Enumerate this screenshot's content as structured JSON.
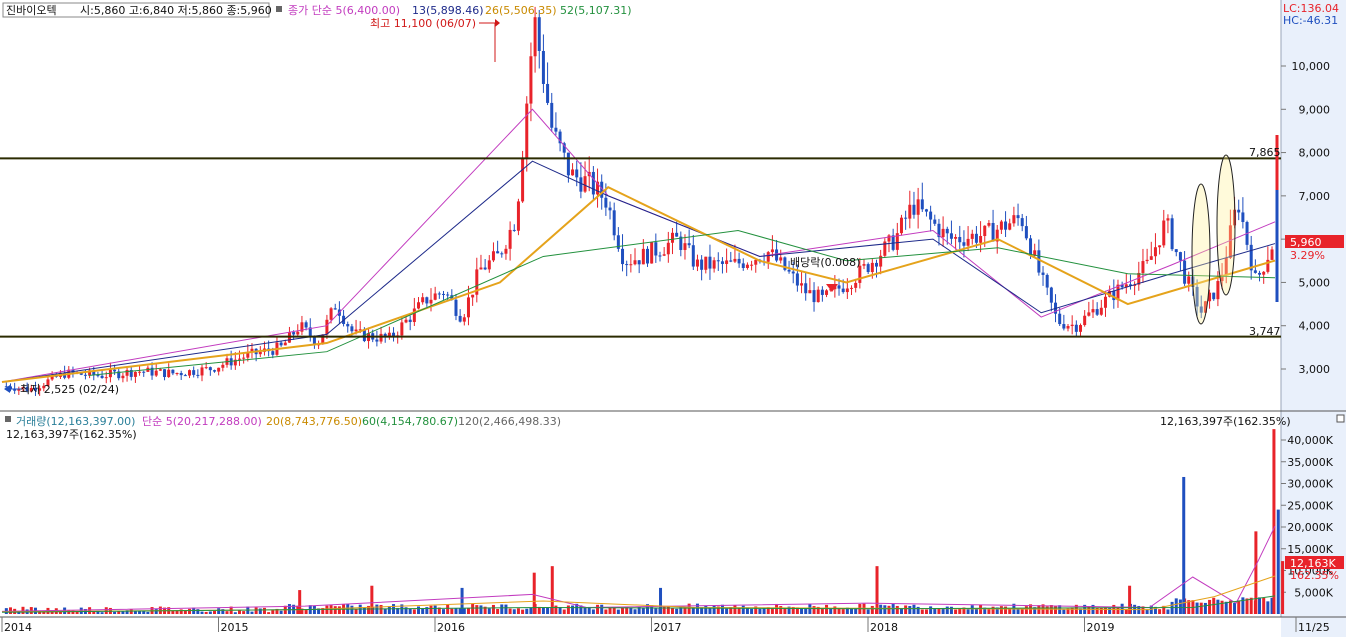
{
  "title_box": {
    "stock": "진바이오텍",
    "ohlc": "시:5,860 고:6,840 저:5,860 종:5,960"
  },
  "price_legend": {
    "base": "종가 단순 5(6,400.00)",
    "ma13": "13(5,898.46)",
    "ma26": "26(5,506.35)",
    "ma52": "52(5,107.31)"
  },
  "lc_hc": {
    "lc": "LC:136.04",
    "hc": "HC:-46.31"
  },
  "annotations": {
    "high": "최고 11,100 (06/07)",
    "low": "최저 2,525 (02/24)",
    "dividend": "배당락(0.008)",
    "level_top": "7,865",
    "level_bottom": "3,747",
    "last_price": "5,960",
    "last_change": "3.29%"
  },
  "volume_legend": {
    "vol": "거래량(12,163,397.00)",
    "ma5": "단순 5(20,217,288.00)",
    "ma20": "20(8,743,776.50)",
    "ma60": "60(4,154,780.67)",
    "ma120": "120(2,466,498.33)",
    "sub": "12,163,397주(162.35%)",
    "right": "12,163,397주(162.35%)",
    "last_vol": "12,163K",
    "last_vol_pct": "162.35%"
  },
  "x_axis": [
    "2014",
    "2015",
    "2016",
    "2017",
    "2018",
    "2019",
    "11/25"
  ],
  "colors": {
    "up": "#e8232a",
    "down": "#1f4fbf",
    "ma5": "#c23bbf",
    "ma13": "#1e2a8a",
    "ma26": "#e5a31b",
    "ma52": "#23913e",
    "level": "#2b2b00",
    "axis_bg": "#e9f0fb"
  },
  "chart_data": {
    "type": "candlestick",
    "frequency": "weekly",
    "price_axis": {
      "ticks": [
        3000,
        4000,
        5000,
        6000,
        7000,
        8000,
        9000,
        10000
      ],
      "labels": [
        "3,000",
        "4,000",
        "5,000",
        "6,000",
        "7,000",
        "8,000",
        "9,000",
        "10,000"
      ],
      "range": [
        2200,
        11300
      ]
    },
    "volume_axis": {
      "ticks": [
        5000,
        10000,
        15000,
        20000,
        25000,
        30000,
        35000,
        40000
      ],
      "labels": [
        "5,000K",
        "10,000K",
        "15,000K",
        "20,000K",
        "25,000K",
        "30,000K",
        "35,000K",
        "40,000K"
      ],
      "unit": "K shares",
      "range": [
        0,
        44500
      ]
    },
    "horizontal_levels": [
      7865,
      3747
    ],
    "close_path": [
      [
        "2014-01",
        2600
      ],
      [
        "2014-02",
        2525
      ],
      [
        "2014-04",
        2900
      ],
      [
        "2014-06",
        2850
      ],
      [
        "2014-08",
        2950
      ],
      [
        "2014-10",
        2900
      ],
      [
        "2014-12",
        3000
      ],
      [
        "2015-02",
        3300
      ],
      [
        "2015-04",
        3500
      ],
      [
        "2015-05",
        4000
      ],
      [
        "2015-06",
        3600
      ],
      [
        "2015-07",
        4500
      ],
      [
        "2015-08",
        3800
      ],
      [
        "2015-10",
        3700
      ],
      [
        "2015-12",
        4600
      ],
      [
        "2016-01",
        4800
      ],
      [
        "2016-02",
        4200
      ],
      [
        "2016-03",
        5300
      ],
      [
        "2016-04",
        5600
      ],
      [
        "2016-05",
        6500
      ],
      [
        "2016-06",
        11100
      ],
      [
        "2016-07",
        8500
      ],
      [
        "2016-08",
        7500
      ],
      [
        "2016-09",
        7300
      ],
      [
        "2016-10",
        6900
      ],
      [
        "2016-11",
        5500
      ],
      [
        "2016-12",
        5600
      ],
      [
        "2017-02",
        6000
      ],
      [
        "2017-03",
        5400
      ],
      [
        "2017-05",
        5400
      ],
      [
        "2017-07",
        5700
      ],
      [
        "2017-09",
        4800
      ],
      [
        "2017-10",
        4600
      ],
      [
        "2017-12",
        5200
      ],
      [
        "2018-02",
        6000
      ],
      [
        "2018-03",
        6800
      ],
      [
        "2018-05",
        6000
      ],
      [
        "2018-07",
        6100
      ],
      [
        "2018-09",
        6500
      ],
      [
        "2018-10",
        5200
      ],
      [
        "2018-11",
        4100
      ],
      [
        "2018-12",
        4000
      ],
      [
        "2019-02",
        4700
      ],
      [
        "2019-04",
        5400
      ],
      [
        "2019-05",
        6400
      ],
      [
        "2019-06",
        5200
      ],
      [
        "2019-07",
        4300
      ],
      [
        "2019-08",
        5000
      ],
      [
        "2019-09",
        6900
      ],
      [
        "2019-10",
        5000
      ],
      [
        "2019-11",
        5960
      ]
    ],
    "moving_averages": [
      {
        "name": "5",
        "values": [
          [
            2014,
            2700
          ],
          [
            2015.5,
            4000
          ],
          [
            2016.45,
            9000
          ],
          [
            2016.8,
            7000
          ],
          [
            2017.5,
            5600
          ],
          [
            2018.3,
            6200
          ],
          [
            2018.8,
            4200
          ],
          [
            2019.4,
            5400
          ],
          [
            2019.88,
            6400
          ]
        ]
      },
      {
        "name": "13",
        "values": [
          [
            2014,
            2700
          ],
          [
            2015.5,
            3800
          ],
          [
            2016.45,
            7800
          ],
          [
            2016.8,
            7000
          ],
          [
            2017.5,
            5600
          ],
          [
            2018.3,
            6000
          ],
          [
            2018.8,
            4300
          ],
          [
            2019.4,
            5200
          ],
          [
            2019.88,
            5898
          ]
        ]
      },
      {
        "name": "26",
        "values": [
          [
            2014,
            2700
          ],
          [
            2015.5,
            3600
          ],
          [
            2016.3,
            5000
          ],
          [
            2016.8,
            7200
          ],
          [
            2017.5,
            5500
          ],
          [
            2017.9,
            5000
          ],
          [
            2018.6,
            6000
          ],
          [
            2019.2,
            4500
          ],
          [
            2019.88,
            5506
          ]
        ]
      },
      {
        "name": "52",
        "values": [
          [
            2014.4,
            2850
          ],
          [
            2015.5,
            3400
          ],
          [
            2016.5,
            5600
          ],
          [
            2017.4,
            6200
          ],
          [
            2017.9,
            5500
          ],
          [
            2018.6,
            5800
          ],
          [
            2019.2,
            5200
          ],
          [
            2019.88,
            5107
          ]
        ]
      }
    ],
    "volume_spikes_k": [
      [
        "2015-05",
        5500
      ],
      [
        "2015-09",
        6500
      ],
      [
        "2016-02",
        6000
      ],
      [
        "2016-06",
        9500
      ],
      [
        "2016-07",
        11000
      ],
      [
        "2017-01",
        6000
      ],
      [
        "2018-01",
        11000
      ],
      [
        "2019-03",
        6500
      ],
      [
        "2019-06",
        31500
      ],
      [
        "2019-10",
        19000
      ],
      [
        "2019-11",
        42500
      ],
      [
        "2019-11",
        24000
      ],
      [
        "2019-11",
        12163
      ]
    ]
  }
}
